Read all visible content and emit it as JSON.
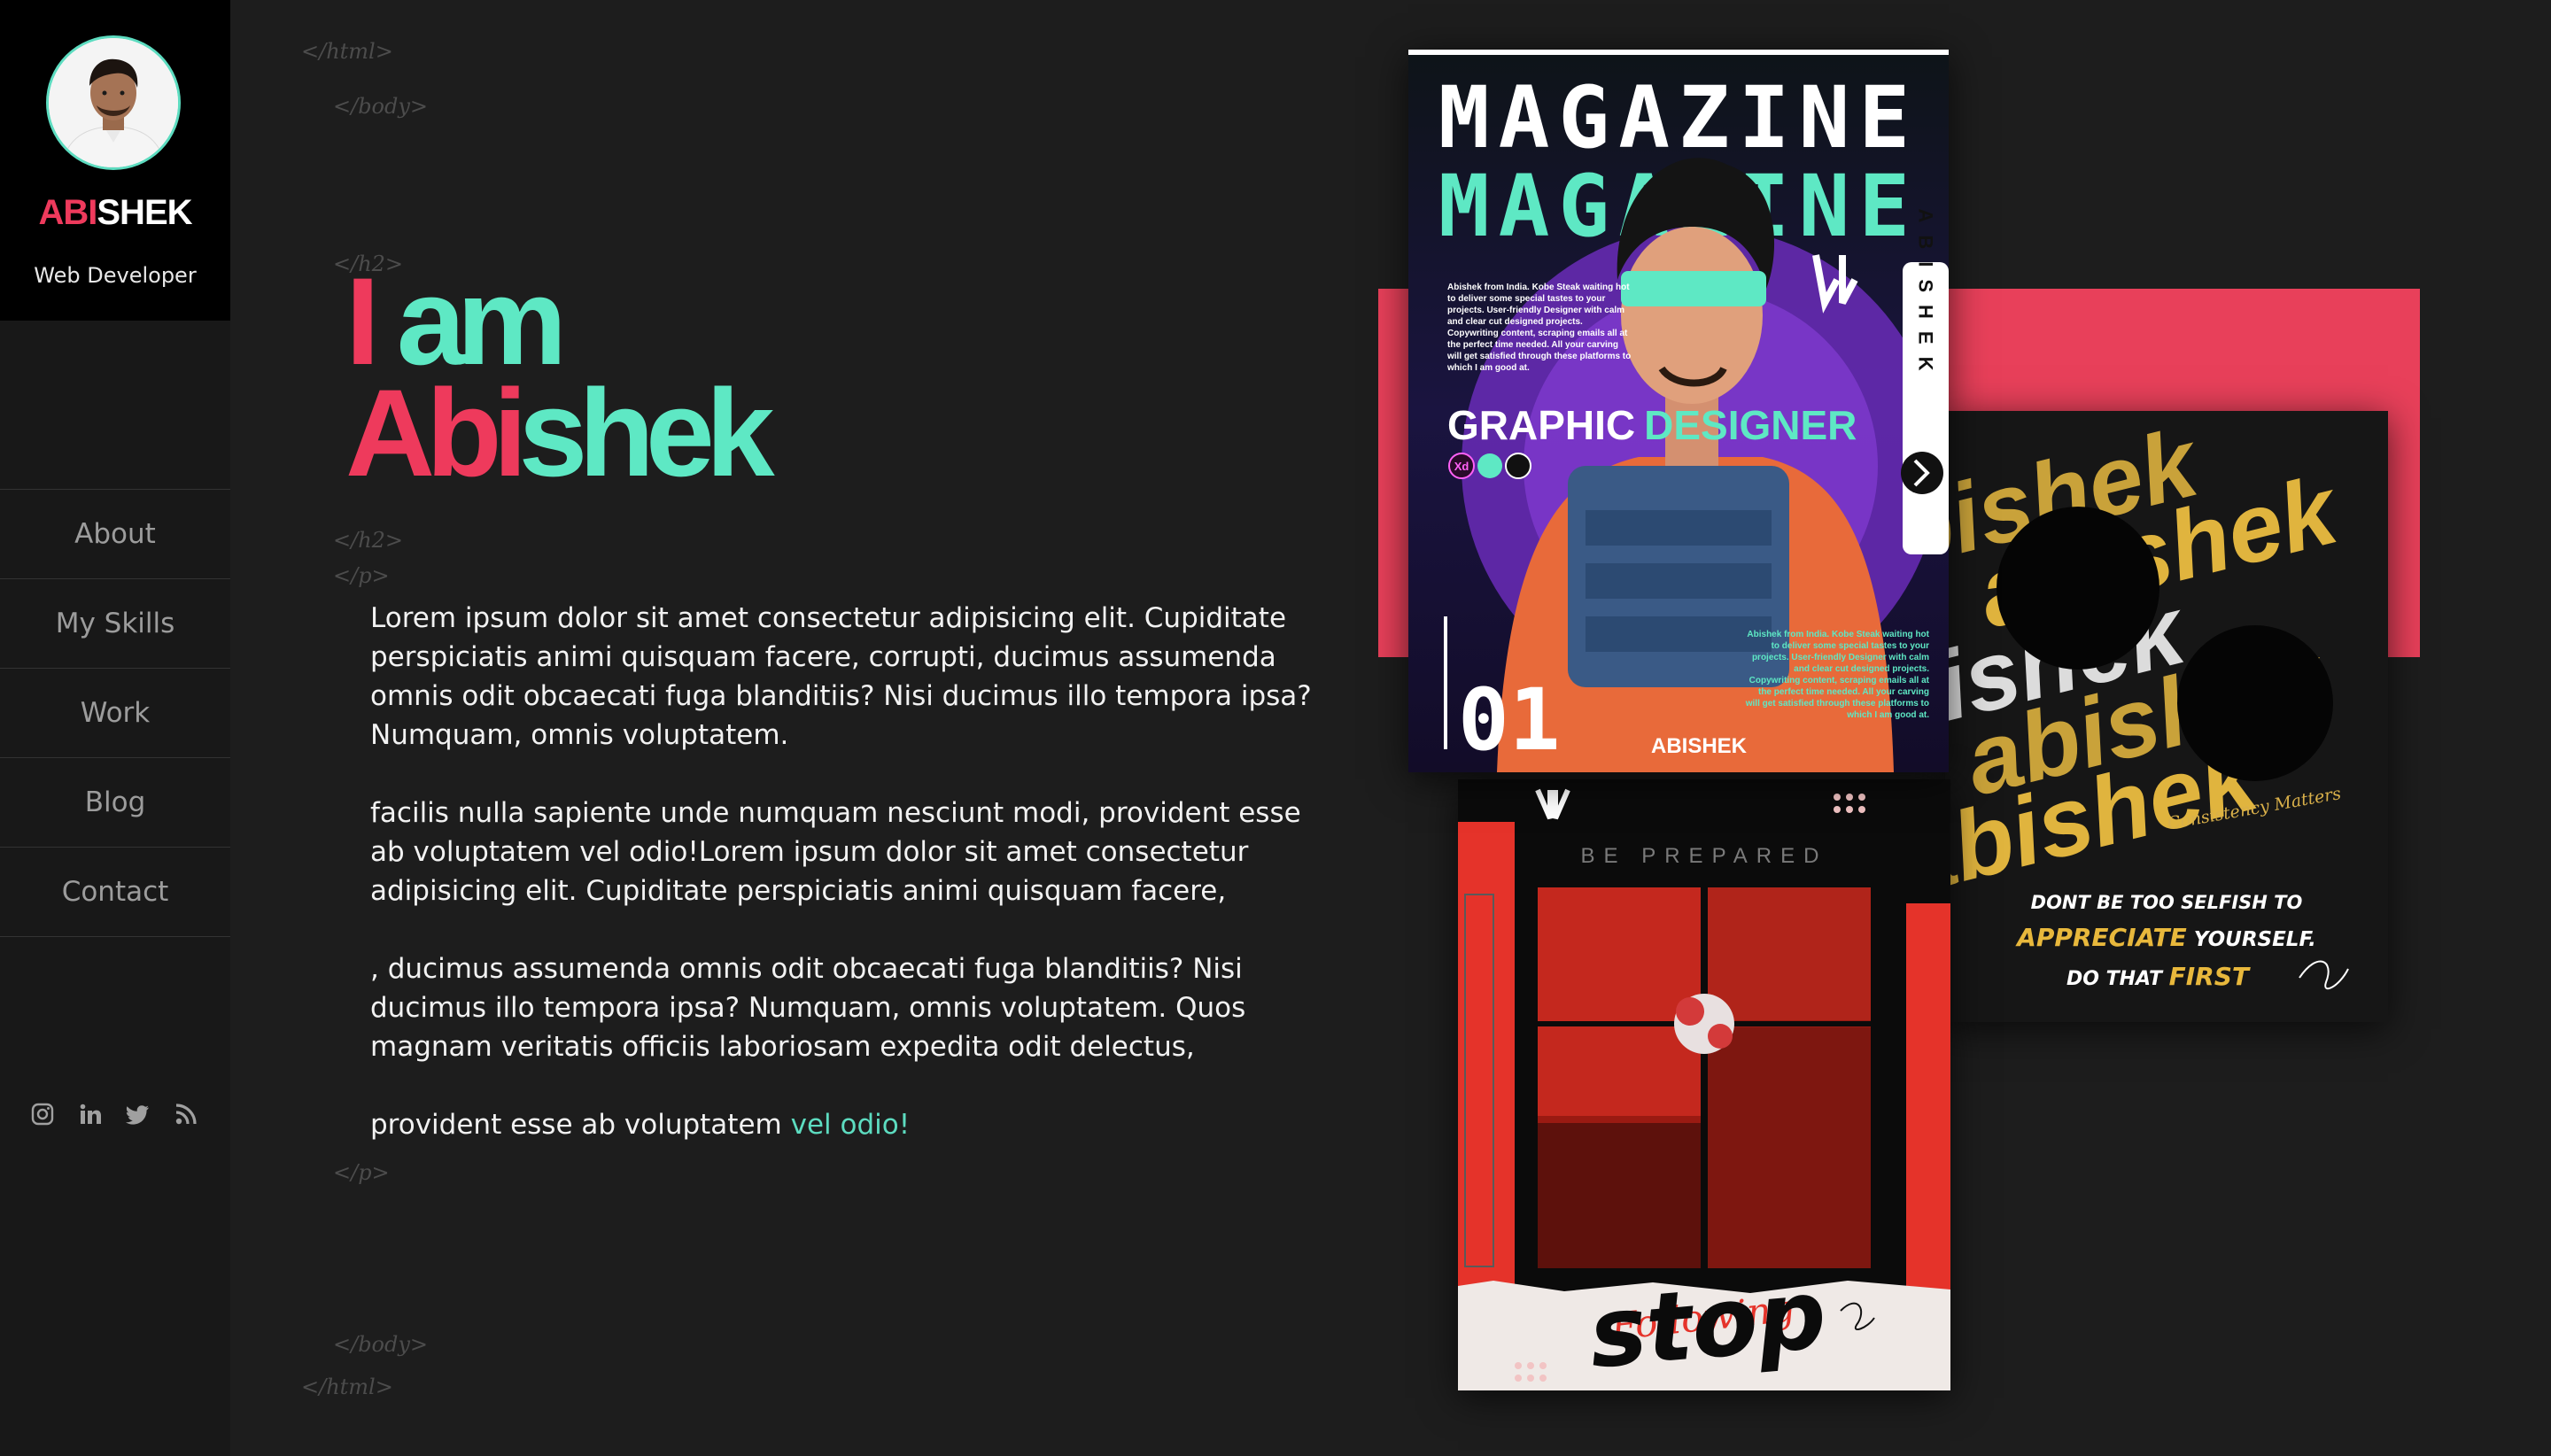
{
  "profile": {
    "brand_first": "ABI",
    "brand_rest": "SHEK",
    "role": "Web Developer"
  },
  "nav": [
    "About",
    "My Skills",
    "Work",
    "Blog",
    "Contact"
  ],
  "social_icons": [
    "instagram-icon",
    "linkedin-icon",
    "twitter-icon",
    "rss-icon"
  ],
  "code_tags": {
    "html_open": "</html>",
    "body_open": "</body>",
    "h2_open": "</h2>",
    "h2_close": "</h2>",
    "p_open": "</p>",
    "p_close": "</p>",
    "body_close": "</body>",
    "html_close": "</html>"
  },
  "hero": {
    "i": "I",
    "am": " am",
    "abi": "Abi",
    "shek": "shek"
  },
  "paragraphs": [
    "Lorem ipsum dolor sit amet consectetur adipisicing elit. Cupiditate perspiciatis animi quisquam facere, corrupti, ducimus assumenda omnis odit obcaecati fuga blanditiis? Nisi ducimus illo tempora ipsa? Numquam, omnis voluptatem.",
    "facilis nulla sapiente unde numquam nesciunt modi, provident esse ab voluptatem vel odio!Lorem ipsum dolor sit amet consectetur adipisicing elit. Cupiditate perspiciatis animi quisquam facere,",
    ", ducimus assumenda omnis odit obcaecati fuga blanditiis? Nisi ducimus illo tempora ipsa? Numquam, omnis voluptatem. Quos magnam veritatis officiis laboriosam expedita odit delectus,"
  ],
  "last_paragraph": {
    "text": "provident esse ab voluptatem ",
    "link": "vel odio!"
  },
  "portfolio": {
    "magazine": {
      "title_top": "MAGAZINE",
      "title_bottom": "MAGAZINE",
      "role": "GRAPHIC",
      "role_accent": "DESIGNER",
      "side_text": "ABISHEK",
      "issue": "01",
      "footer_brand": "ABISHEK",
      "blurb": "Abishek from India. Kobe Steak waiting hot to deliver some special tastes to your projects. User-friendly Designer with calm and clear cut designed projects. Copywriting content, scraping emails all at the perfect time needed. All your carving will get satisfied through these platforms to which I am good at.",
      "badge": "Xd"
    },
    "poster_stop": {
      "tagline": "BE PREPARED",
      "word": "stop",
      "script": "Following"
    },
    "poster_abishek": {
      "repeat": "abishek",
      "signature": "Consistency Matters",
      "line1": "DONT BE TOO SELFISH TO",
      "line2_accent": "APPRECIATE",
      "line2_rest": " YOURSELF.",
      "line3": "DO THAT ",
      "line3_accent": "FIRST"
    }
  },
  "colors": {
    "accent_red": "#ee3a5c",
    "accent_teal": "#5ee8c4",
    "background": "#1d1d1d",
    "sidebar": "#181818"
  }
}
